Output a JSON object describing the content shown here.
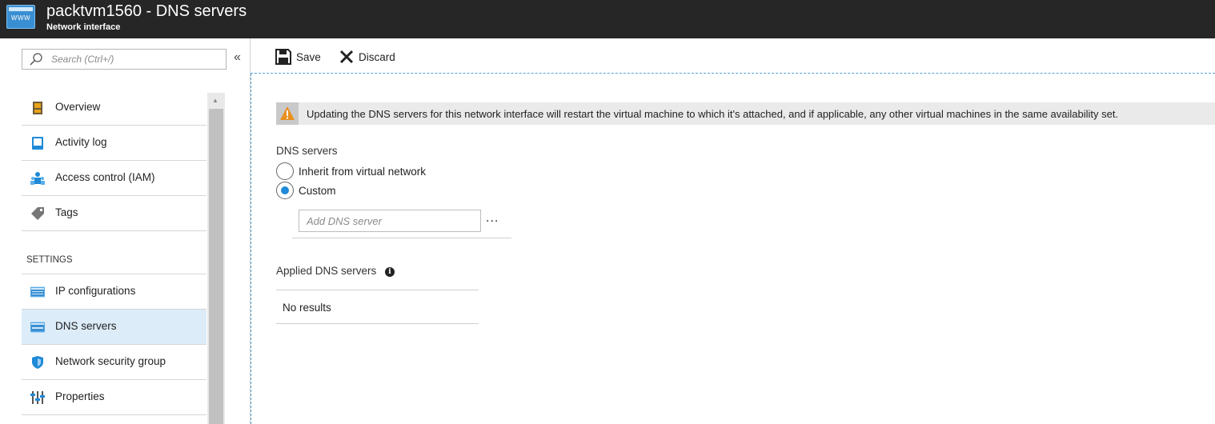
{
  "header": {
    "logo_text": "WWW",
    "title": "packtvm1560 - DNS servers",
    "subtitle": "Network interface"
  },
  "sidebar": {
    "search_placeholder": "Search (Ctrl+/)",
    "collapse_glyph": "«",
    "items_top": [
      {
        "label": "Overview",
        "icon": "overview-icon"
      },
      {
        "label": "Activity log",
        "icon": "activity-log-icon"
      },
      {
        "label": "Access control (IAM)",
        "icon": "iam-icon"
      },
      {
        "label": "Tags",
        "icon": "tag-icon"
      }
    ],
    "section_settings": "SETTINGS",
    "items_settings": [
      {
        "label": "IP configurations",
        "icon": "ip-config-icon"
      },
      {
        "label": "DNS servers",
        "icon": "dns-icon",
        "active": true
      },
      {
        "label": "Network security group",
        "icon": "shield-icon"
      },
      {
        "label": "Properties",
        "icon": "properties-icon"
      }
    ]
  },
  "toolbar": {
    "save_label": "Save",
    "discard_label": "Discard"
  },
  "main": {
    "warning_text": "Updating the DNS servers for this network interface will restart the virtual machine to which it's attached, and if applicable, any other virtual machines in the same availability set.",
    "dns_servers_label": "DNS servers",
    "radio_inherit": "Inherit from virtual network",
    "radio_custom": "Custom",
    "selected_option": "Custom",
    "add_dns_placeholder": "Add DNS server",
    "more_glyph": "...",
    "applied_label": "Applied DNS servers",
    "info_glyph": "i",
    "no_results": "No results"
  },
  "colors": {
    "topbar_bg": "#262626",
    "accent": "#1f8ad8",
    "active_item_bg": "#dcecf9",
    "warning_bg": "#eaeaea",
    "warning_icon": "#e8901f"
  }
}
